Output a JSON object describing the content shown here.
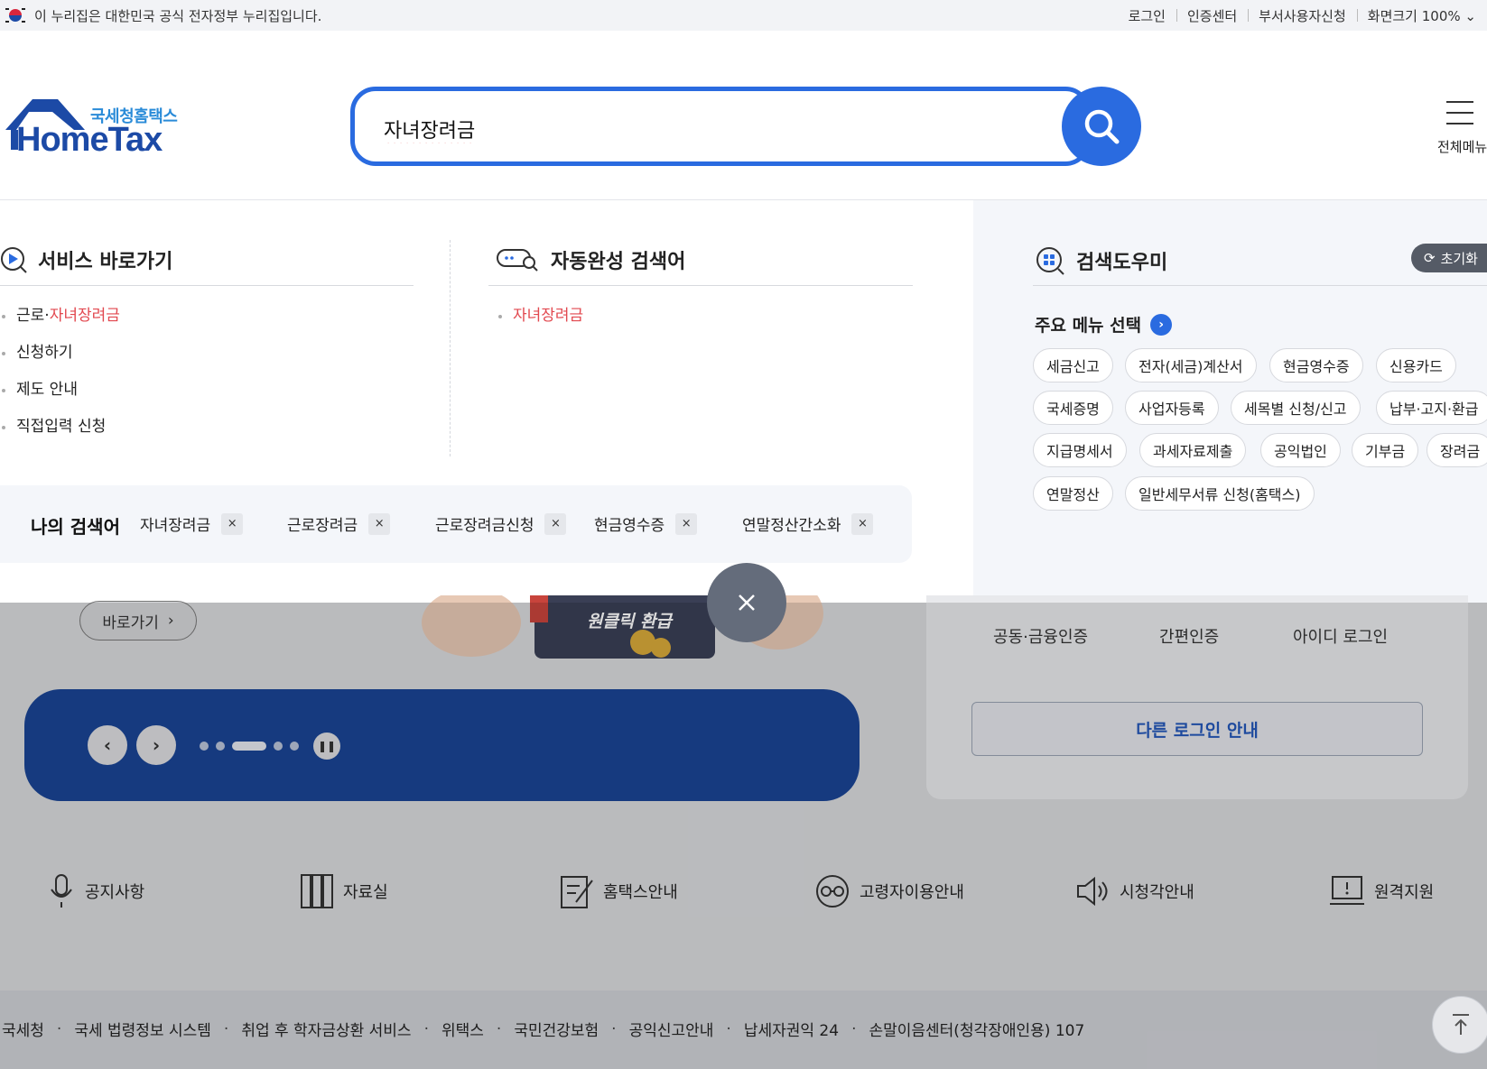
{
  "gov_bar": {
    "notice": "이 누리집은 대한민국 공식 전자정부 누리집입니다.",
    "links": [
      "로그인",
      "인증센터",
      "부서사용자신청",
      "화면크기 100%"
    ]
  },
  "header": {
    "logo_sub": "국세청홈택스",
    "logo_main": "HomeTax",
    "search_value": "자녀장려금",
    "menu_label": "전체메뉴"
  },
  "service_shortcuts": {
    "title": "서비스 바로가기",
    "items": [
      {
        "prefix": "근로·",
        "highlight": "자녀장려금"
      },
      {
        "prefix": "신청하기",
        "highlight": ""
      },
      {
        "prefix": "제도 안내",
        "highlight": ""
      },
      {
        "prefix": "직접입력 신청",
        "highlight": ""
      }
    ]
  },
  "autocomplete": {
    "title": "자동완성 검색어",
    "items": [
      "자녀장려금"
    ]
  },
  "my_searches": {
    "title": "나의 검색어",
    "items": [
      "자녀장려금",
      "근로장려금",
      "근로장려금신청",
      "현금영수증",
      "연말정산간소화"
    ],
    "remove_glyph": "×"
  },
  "search_helper": {
    "title": "검색도우미",
    "reset_label": "초기화",
    "main_menu_title": "주요 메뉴 선택",
    "chips": [
      "세금신고",
      "전자(세금)계산서",
      "현금영수증",
      "신용카드",
      "국세증명",
      "사업자등록",
      "세목별 신청/신고",
      "납부·고지·환급",
      "지급명세서",
      "과세자료제출",
      "공익법인",
      "기부금",
      "장려금",
      "연말정산",
      "일반세무서류 신청(홈택스)"
    ]
  },
  "background": {
    "goto_label": "바로가기",
    "banner_label": "원클릭 환급",
    "login_options": [
      "공동·금융인증",
      "간편인증",
      "아이디 로그인"
    ],
    "other_login": "다른 로그인 안내",
    "quick_links": [
      "공지사항",
      "자료실",
      "홈택스안내",
      "고령자이용안내",
      "시청각안내",
      "원격지원"
    ],
    "footer_links": [
      "국세청",
      "국세 법령정보 시스템",
      "취업 후 학자금상환 서비스",
      "위택스",
      "국민건강보험",
      "공익신고안내",
      "납세자권익 24",
      "손말이음센터(청각장애인용) 107"
    ]
  }
}
